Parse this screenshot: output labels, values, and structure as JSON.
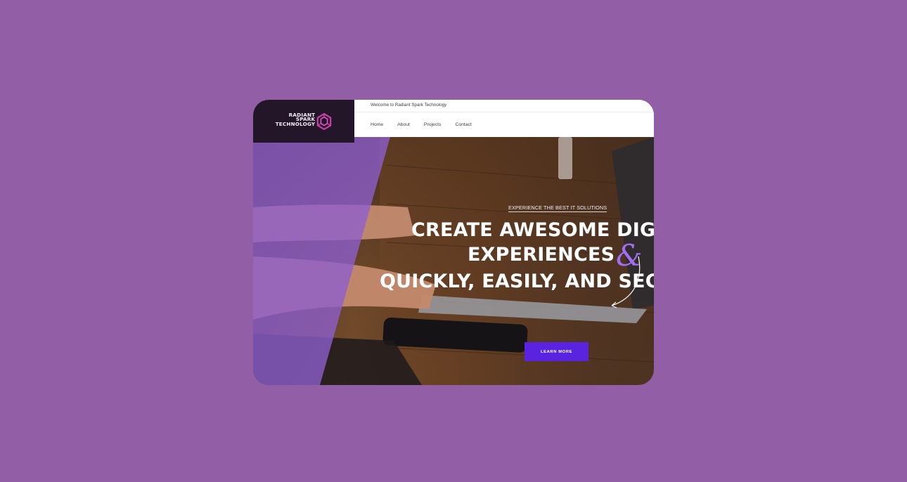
{
  "brand": {
    "logo_line1": "RADIANT",
    "logo_line2": "SPARK",
    "logo_line3": "TECHNOLOGY",
    "accent": "#c93fa8"
  },
  "topbar": {
    "welcome": "Welcome to Radiant Spark Technology"
  },
  "nav": {
    "items": [
      "Home",
      "About",
      "Projects",
      "Contact"
    ]
  },
  "hero": {
    "eyebrow": "EXPERIENCE THE BEST IT SOLUTIONS",
    "line1": "CREATE AWESOME DIG",
    "line2": "EXPERIENCES",
    "amp": "&",
    "line3": "QUICKLY, EASILY, AND SEC",
    "cta_label": "LEARN MORE",
    "cta_color": "#5a23e0",
    "overlay_color": "#8e5fd0"
  },
  "page_background": "#925ea6"
}
